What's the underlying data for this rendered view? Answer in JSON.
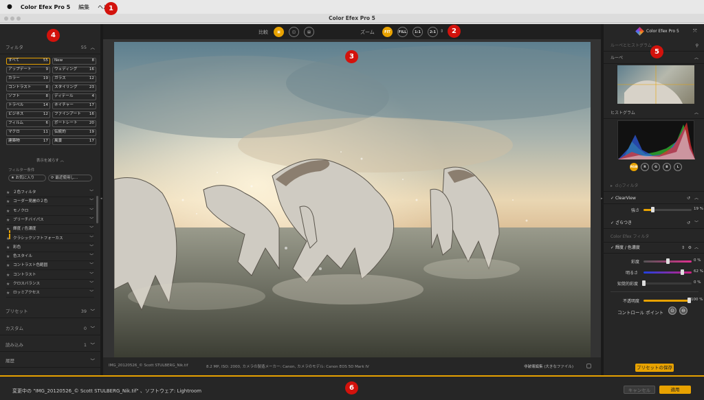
{
  "menubar": {
    "app_name": "Color Efex Pro 5",
    "items": [
      "編集",
      "ヘルプ"
    ]
  },
  "window": {
    "title": "Color Efex Pro 5"
  },
  "badges": [
    "1",
    "2",
    "3",
    "4",
    "5",
    "6"
  ],
  "left": {
    "filters": {
      "title": "フィルタ",
      "count": "55"
    },
    "categories": [
      {
        "label": "すべて",
        "count": "55",
        "selected": true
      },
      {
        "label": "New",
        "count": "8"
      },
      {
        "label": "アップデート",
        "count": "9"
      },
      {
        "label": "ウェディング",
        "count": "16"
      },
      {
        "label": "カラー",
        "count": "19"
      },
      {
        "label": "ガラス",
        "count": "12"
      },
      {
        "label": "コントラスト",
        "count": "8"
      },
      {
        "label": "スタイリング",
        "count": "23"
      },
      {
        "label": "ソフト",
        "count": "8"
      },
      {
        "label": "ディテール",
        "count": "4"
      },
      {
        "label": "トラベル",
        "count": "14"
      },
      {
        "label": "ネイチャー",
        "count": "17"
      },
      {
        "label": "ビジネス",
        "count": "12"
      },
      {
        "label": "ファインアート",
        "count": "16"
      },
      {
        "label": "フィルム",
        "count": "6"
      },
      {
        "label": "ポートレート",
        "count": "20"
      },
      {
        "label": "マクロ",
        "count": "11"
      },
      {
        "label": "伝統的",
        "count": "19"
      },
      {
        "label": "建築物",
        "count": "17"
      },
      {
        "label": "風景",
        "count": "17"
      }
    ],
    "show_less": "表示を減らす",
    "filter_criteria": "フィルター条件",
    "favorites_pill": "★ お気に入り",
    "recent_pill": "⟳ 最近使用し...",
    "filter_list": [
      "２色フィルタ",
      "コーダー見麗の２色",
      "モノクロ",
      "ブリーチバイパス",
      "輝度 / 色濃度",
      "クラシックソフトフォーカス",
      "彩色",
      "色スタイル",
      "コントラスト色範囲",
      "コントラスト",
      "クロスバランス",
      "ロッミアクセス"
    ],
    "presets": {
      "title": "プリセット",
      "count": "39"
    },
    "custom": {
      "title": "カスタム",
      "count": "0"
    },
    "import": {
      "title": "読み込み",
      "count": "1"
    },
    "history": {
      "title": "履歴"
    }
  },
  "toolbar": {
    "compare": "比較",
    "zoom": "ズーム",
    "fit": "FIT",
    "fill": "FILL",
    "z11": "1:1",
    "z21": "2:1"
  },
  "info": {
    "file": "IMG_20120526_© Scott STULBERG_Nik.tif",
    "meta": "8.2 MP, ISO: 2000, カメラの製造メーカー: Canon, カメラのモデル: Canon EOS 5D Mark IV",
    "nondestructive": "非破壊編集 (大きなファイル)"
  },
  "right": {
    "app_name": "Color Efex Pro 5",
    "loupe_section": "ルーペとヒストグラム",
    "loupe": "ルーペ",
    "histogram": "ヒストグラム",
    "channels": [
      "RGB",
      "R",
      "G",
      "B",
      "L"
    ],
    "border_filter": "ｄ◇フィルタ",
    "clearview": "ClearView",
    "strength": "強さ",
    "strength_value": "19 %",
    "strength_level": 0.19,
    "grain": "ざらつき",
    "color_efex_filters": "Color Efex フィルタ",
    "filter_name": "輝度 / 色濃度",
    "saturation": "彩度",
    "saturation_value": "0 %",
    "saturation_level": 0.5,
    "brightness": "明るさ",
    "brightness_value": "62 %",
    "brightness_level": 0.81,
    "perceived": "知覚的彩度",
    "perceived_value": "0 %",
    "perceived_level": 0.0,
    "opacity": "不透明度",
    "opacity_value": "100 %",
    "opacity_level": 1.0,
    "control_points": "コントロール ポイント",
    "save_preset": "プリセットの保存"
  },
  "footer": {
    "status": "変更中の \"IMG_20120526_© Scott STULBERG_Nik.tif\" 、ソフトウェア: Lightroom",
    "cancel": "キャンセル",
    "apply": "適用"
  },
  "colors": {
    "accent": "#e8a200",
    "badge": "#d3120c"
  }
}
